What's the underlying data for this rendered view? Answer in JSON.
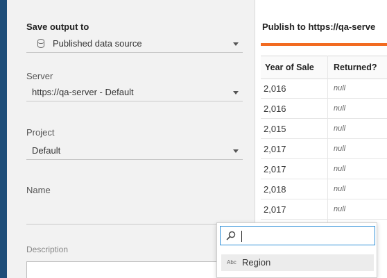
{
  "output": {
    "section_title": "Save output to",
    "output_type": "Published data source",
    "server_label": "Server",
    "server_value": "https://qa-server - Default",
    "project_label": "Project",
    "project_value": "Default",
    "name_label": "Name",
    "description_label": "Description"
  },
  "preview": {
    "header": "Publish to https://qa-serve",
    "columns": [
      "Year of Sale",
      "Returned?"
    ],
    "rows": [
      [
        "2,016",
        "null"
      ],
      [
        "2,016",
        "null"
      ],
      [
        "2,015",
        "null"
      ],
      [
        "2,017",
        "null"
      ],
      [
        "2,017",
        "null"
      ],
      [
        "2,018",
        "null"
      ],
      [
        "2,017",
        "null"
      ]
    ]
  },
  "field_picker": {
    "search_value": "",
    "items": [
      {
        "type_badge": "Abc",
        "label": "Region"
      }
    ]
  },
  "colors": {
    "accent_bar": "#1f4e79",
    "orange_accent": "#f26b21",
    "search_focus": "#2f8fd8"
  }
}
